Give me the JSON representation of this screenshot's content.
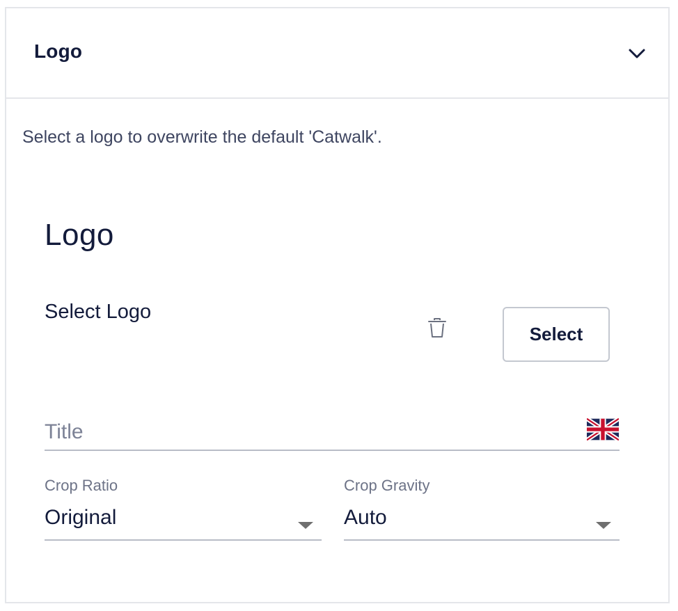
{
  "panel": {
    "title": "Logo",
    "description": "Select a logo to overwrite the default 'Catwalk'."
  },
  "logo_section": {
    "heading": "Logo",
    "select_label": "Select Logo",
    "select_button": "Select"
  },
  "title_field": {
    "placeholder": "Title",
    "value": "",
    "language_flag": "uk-flag-icon"
  },
  "crop_ratio": {
    "label": "Crop Ratio",
    "selected": "Original"
  },
  "crop_gravity": {
    "label": "Crop Gravity",
    "selected": "Auto"
  },
  "colors": {
    "text_primary": "#131b3b",
    "border": "#e4e6ea"
  }
}
